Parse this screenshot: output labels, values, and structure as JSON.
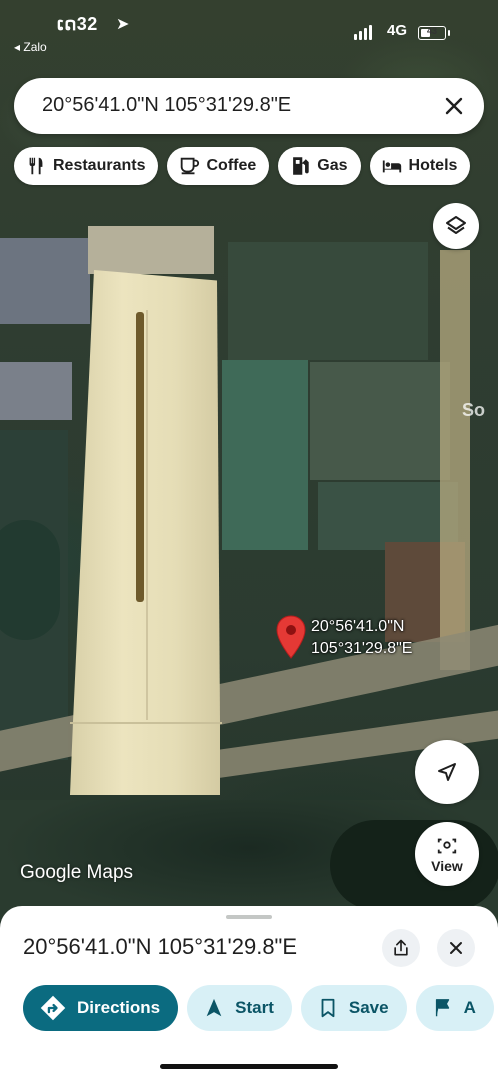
{
  "status_bar": {
    "time": "ເດ32",
    "back_app": "◂ Zalo",
    "network": "4G",
    "battery_level": "43",
    "battery_percent": 43
  },
  "search": {
    "query": "20°56'41.0\"N 105°31'29.8\"E"
  },
  "chips": [
    {
      "label": "Restaurants",
      "icon": "fork-knife-icon"
    },
    {
      "label": "Coffee",
      "icon": "coffee-cup-icon"
    },
    {
      "label": "Gas",
      "icon": "gas-pump-icon"
    },
    {
      "label": "Hotels",
      "icon": "bed-icon"
    }
  ],
  "map": {
    "pin_label_line1": "20°56'41.0\"N",
    "pin_label_line2": "105°31'29.8\"E",
    "watermark": "So",
    "attribution": "Google Maps",
    "pin_color": "#e53935"
  },
  "controls": {
    "layers_icon": "layers-icon",
    "location_icon": "navigation-arrow-icon",
    "view_label": "View"
  },
  "sheet": {
    "title": "20°56'41.0\"N 105°31'29.8\"E",
    "actions": [
      {
        "label": "Directions",
        "icon": "directions-icon"
      },
      {
        "label": "Start",
        "icon": "navigation-icon"
      },
      {
        "label": "Save",
        "icon": "bookmark-icon"
      },
      {
        "label": "A",
        "icon": "flag-icon"
      }
    ]
  },
  "colors": {
    "accent": "#0b6b80",
    "secondary_button": "#d8f0f6"
  }
}
